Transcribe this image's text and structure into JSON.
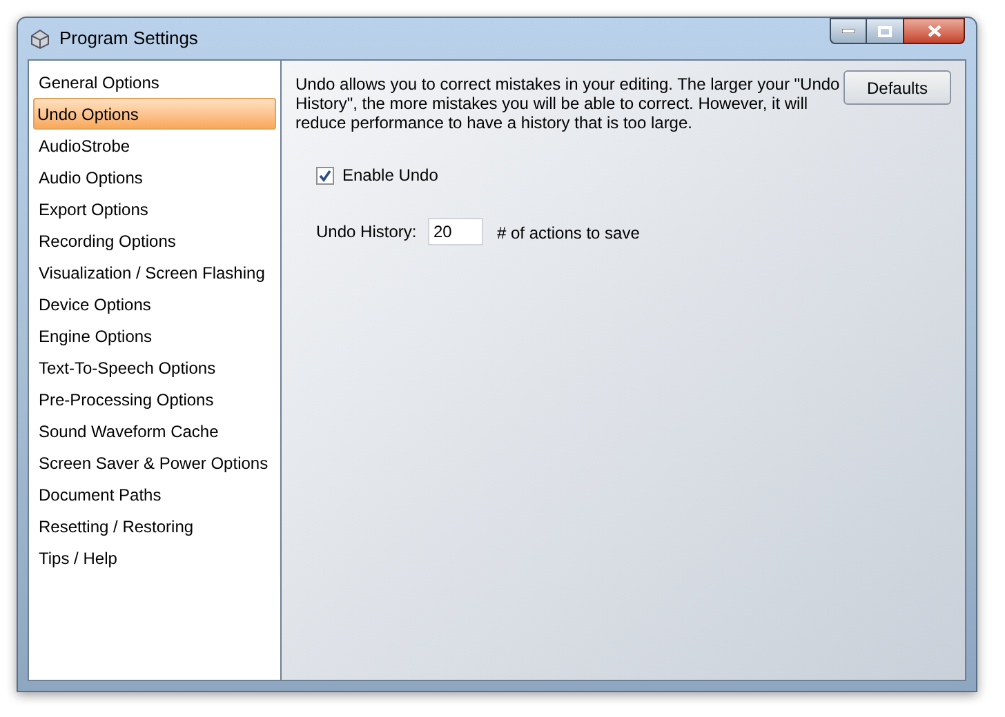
{
  "window": {
    "title": "Program Settings"
  },
  "sidebar": {
    "items": [
      {
        "label": "General Options",
        "selected": false
      },
      {
        "label": "Undo Options",
        "selected": true
      },
      {
        "label": "AudioStrobe",
        "selected": false
      },
      {
        "label": "Audio Options",
        "selected": false
      },
      {
        "label": "Export Options",
        "selected": false
      },
      {
        "label": "Recording Options",
        "selected": false
      },
      {
        "label": "Visualization / Screen Flashing",
        "selected": false
      },
      {
        "label": "Device Options",
        "selected": false
      },
      {
        "label": "Engine Options",
        "selected": false
      },
      {
        "label": "Text-To-Speech Options",
        "selected": false
      },
      {
        "label": "Pre-Processing Options",
        "selected": false
      },
      {
        "label": "Sound Waveform Cache",
        "selected": false
      },
      {
        "label": "Screen Saver & Power Options",
        "selected": false
      },
      {
        "label": "Document Paths",
        "selected": false
      },
      {
        "label": "Resetting / Restoring",
        "selected": false
      },
      {
        "label": "Tips / Help",
        "selected": false
      }
    ]
  },
  "content": {
    "description": "Undo allows you to correct mistakes in your editing. The larger your \"Undo History\", the more mistakes you will be able to correct. However, it will reduce performance to have a history that is too large.",
    "defaults_button": "Defaults",
    "enable_undo": {
      "label": "Enable Undo",
      "checked": true
    },
    "undo_history": {
      "label": "Undo History:",
      "value": "20",
      "suffix": "# of actions to save"
    }
  }
}
